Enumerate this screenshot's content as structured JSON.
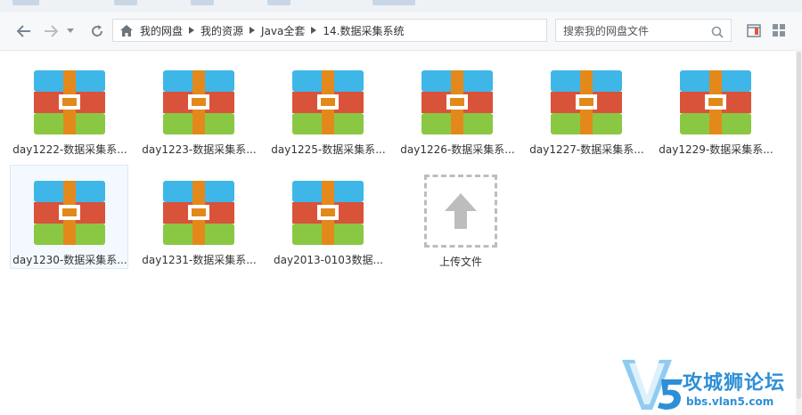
{
  "navigation": {
    "back_icon": "arrow-left-icon",
    "forward_icon": "arrow-right-icon",
    "dropdown_icon": "chevron-down-icon",
    "refresh_icon": "refresh-icon"
  },
  "breadcrumb": {
    "home_icon": "home-icon",
    "items": [
      "我的网盘",
      "我的资源",
      "Java全套",
      "14.数据采集系统"
    ]
  },
  "search": {
    "placeholder": "搜索我的网盘文件",
    "icon": "search-icon"
  },
  "view": {
    "buttons": [
      "preview-pane-icon",
      "grid-view-icon"
    ]
  },
  "files": [
    {
      "name": "day1222-数据采集系...",
      "icon": "archive-icon",
      "selected": false
    },
    {
      "name": "day1223-数据采集系...",
      "icon": "archive-icon",
      "selected": false
    },
    {
      "name": "day1225-数据采集系...",
      "icon": "archive-icon",
      "selected": false
    },
    {
      "name": "day1226-数据采集系...",
      "icon": "archive-icon",
      "selected": false
    },
    {
      "name": "day1227-数据采集系...",
      "icon": "archive-icon",
      "selected": false
    },
    {
      "name": "day1229-数据采集系...",
      "icon": "archive-icon",
      "selected": false
    },
    {
      "name": "day1230-数据采集系...",
      "icon": "archive-icon",
      "selected": true
    },
    {
      "name": "day1231-数据采集系...",
      "icon": "archive-icon",
      "selected": false
    },
    {
      "name": "day2013-0103数据...",
      "icon": "archive-icon",
      "selected": false
    }
  ],
  "upload": {
    "label": "上传文件",
    "icon": "upload-arrow-icon"
  },
  "watermark": {
    "logo_text": "V5",
    "title": "攻城狮论坛",
    "url": "bbs.vlan5.com"
  },
  "colors": {
    "archive_top": "#3fb6e8",
    "archive_middle": "#d9533a",
    "archive_bottom": "#8ac843",
    "archive_strap": "#e3891c",
    "accent": "#2e8fd6"
  }
}
